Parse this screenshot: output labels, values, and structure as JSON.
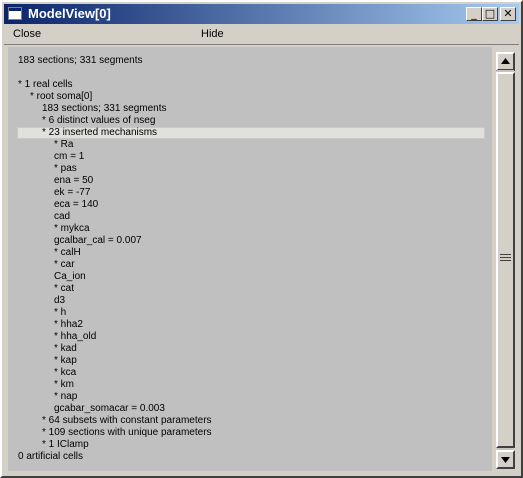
{
  "window": {
    "title": "ModelView[0]"
  },
  "titlebar_buttons": {
    "minimize": "_",
    "maximize": "□",
    "close": "✕"
  },
  "menu": {
    "close_label": "Close",
    "hide_label": "Hide"
  },
  "summary": "183 sections; 331 segments",
  "tree": [
    {
      "text": "* 1 real cells",
      "indent": 0
    },
    {
      "text": "* root soma[0]",
      "indent": 1
    },
    {
      "text": "183 sections; 331 segments",
      "indent": 2
    },
    {
      "text": "* 6 distinct values of nseg",
      "indent": 2
    },
    {
      "text": "* 23 inserted mechanisms",
      "indent": 2,
      "selected": true
    },
    {
      "text": "* Ra",
      "indent": 3
    },
    {
      "text": "cm = 1",
      "indent": 3
    },
    {
      "text": "* pas",
      "indent": 3
    },
    {
      "text": "ena = 50",
      "indent": 3
    },
    {
      "text": "ek = -77",
      "indent": 3
    },
    {
      "text": "eca = 140",
      "indent": 3
    },
    {
      "text": "cad",
      "indent": 3
    },
    {
      "text": "* mykca",
      "indent": 3
    },
    {
      "text": "gcalbar_cal = 0.007",
      "indent": 3
    },
    {
      "text": "* calH",
      "indent": 3
    },
    {
      "text": "* car",
      "indent": 3
    },
    {
      "text": "Ca_ion",
      "indent": 3
    },
    {
      "text": "* cat",
      "indent": 3
    },
    {
      "text": "d3",
      "indent": 3
    },
    {
      "text": "* h",
      "indent": 3
    },
    {
      "text": "* hha2",
      "indent": 3
    },
    {
      "text": "* hha_old",
      "indent": 3
    },
    {
      "text": "* kad",
      "indent": 3
    },
    {
      "text": "* kap",
      "indent": 3
    },
    {
      "text": "* kca",
      "indent": 3
    },
    {
      "text": "* km",
      "indent": 3
    },
    {
      "text": "* nap",
      "indent": 3
    },
    {
      "text": "gcabar_somacar = 0.003",
      "indent": 3
    },
    {
      "text": "* 64 subsets with constant parameters",
      "indent": 2
    },
    {
      "text": "* 109 sections with unique parameters",
      "indent": 2
    },
    {
      "text": "* 1 IClamp",
      "indent": 2
    },
    {
      "text": "0 artificial cells",
      "indent": 0
    }
  ]
}
